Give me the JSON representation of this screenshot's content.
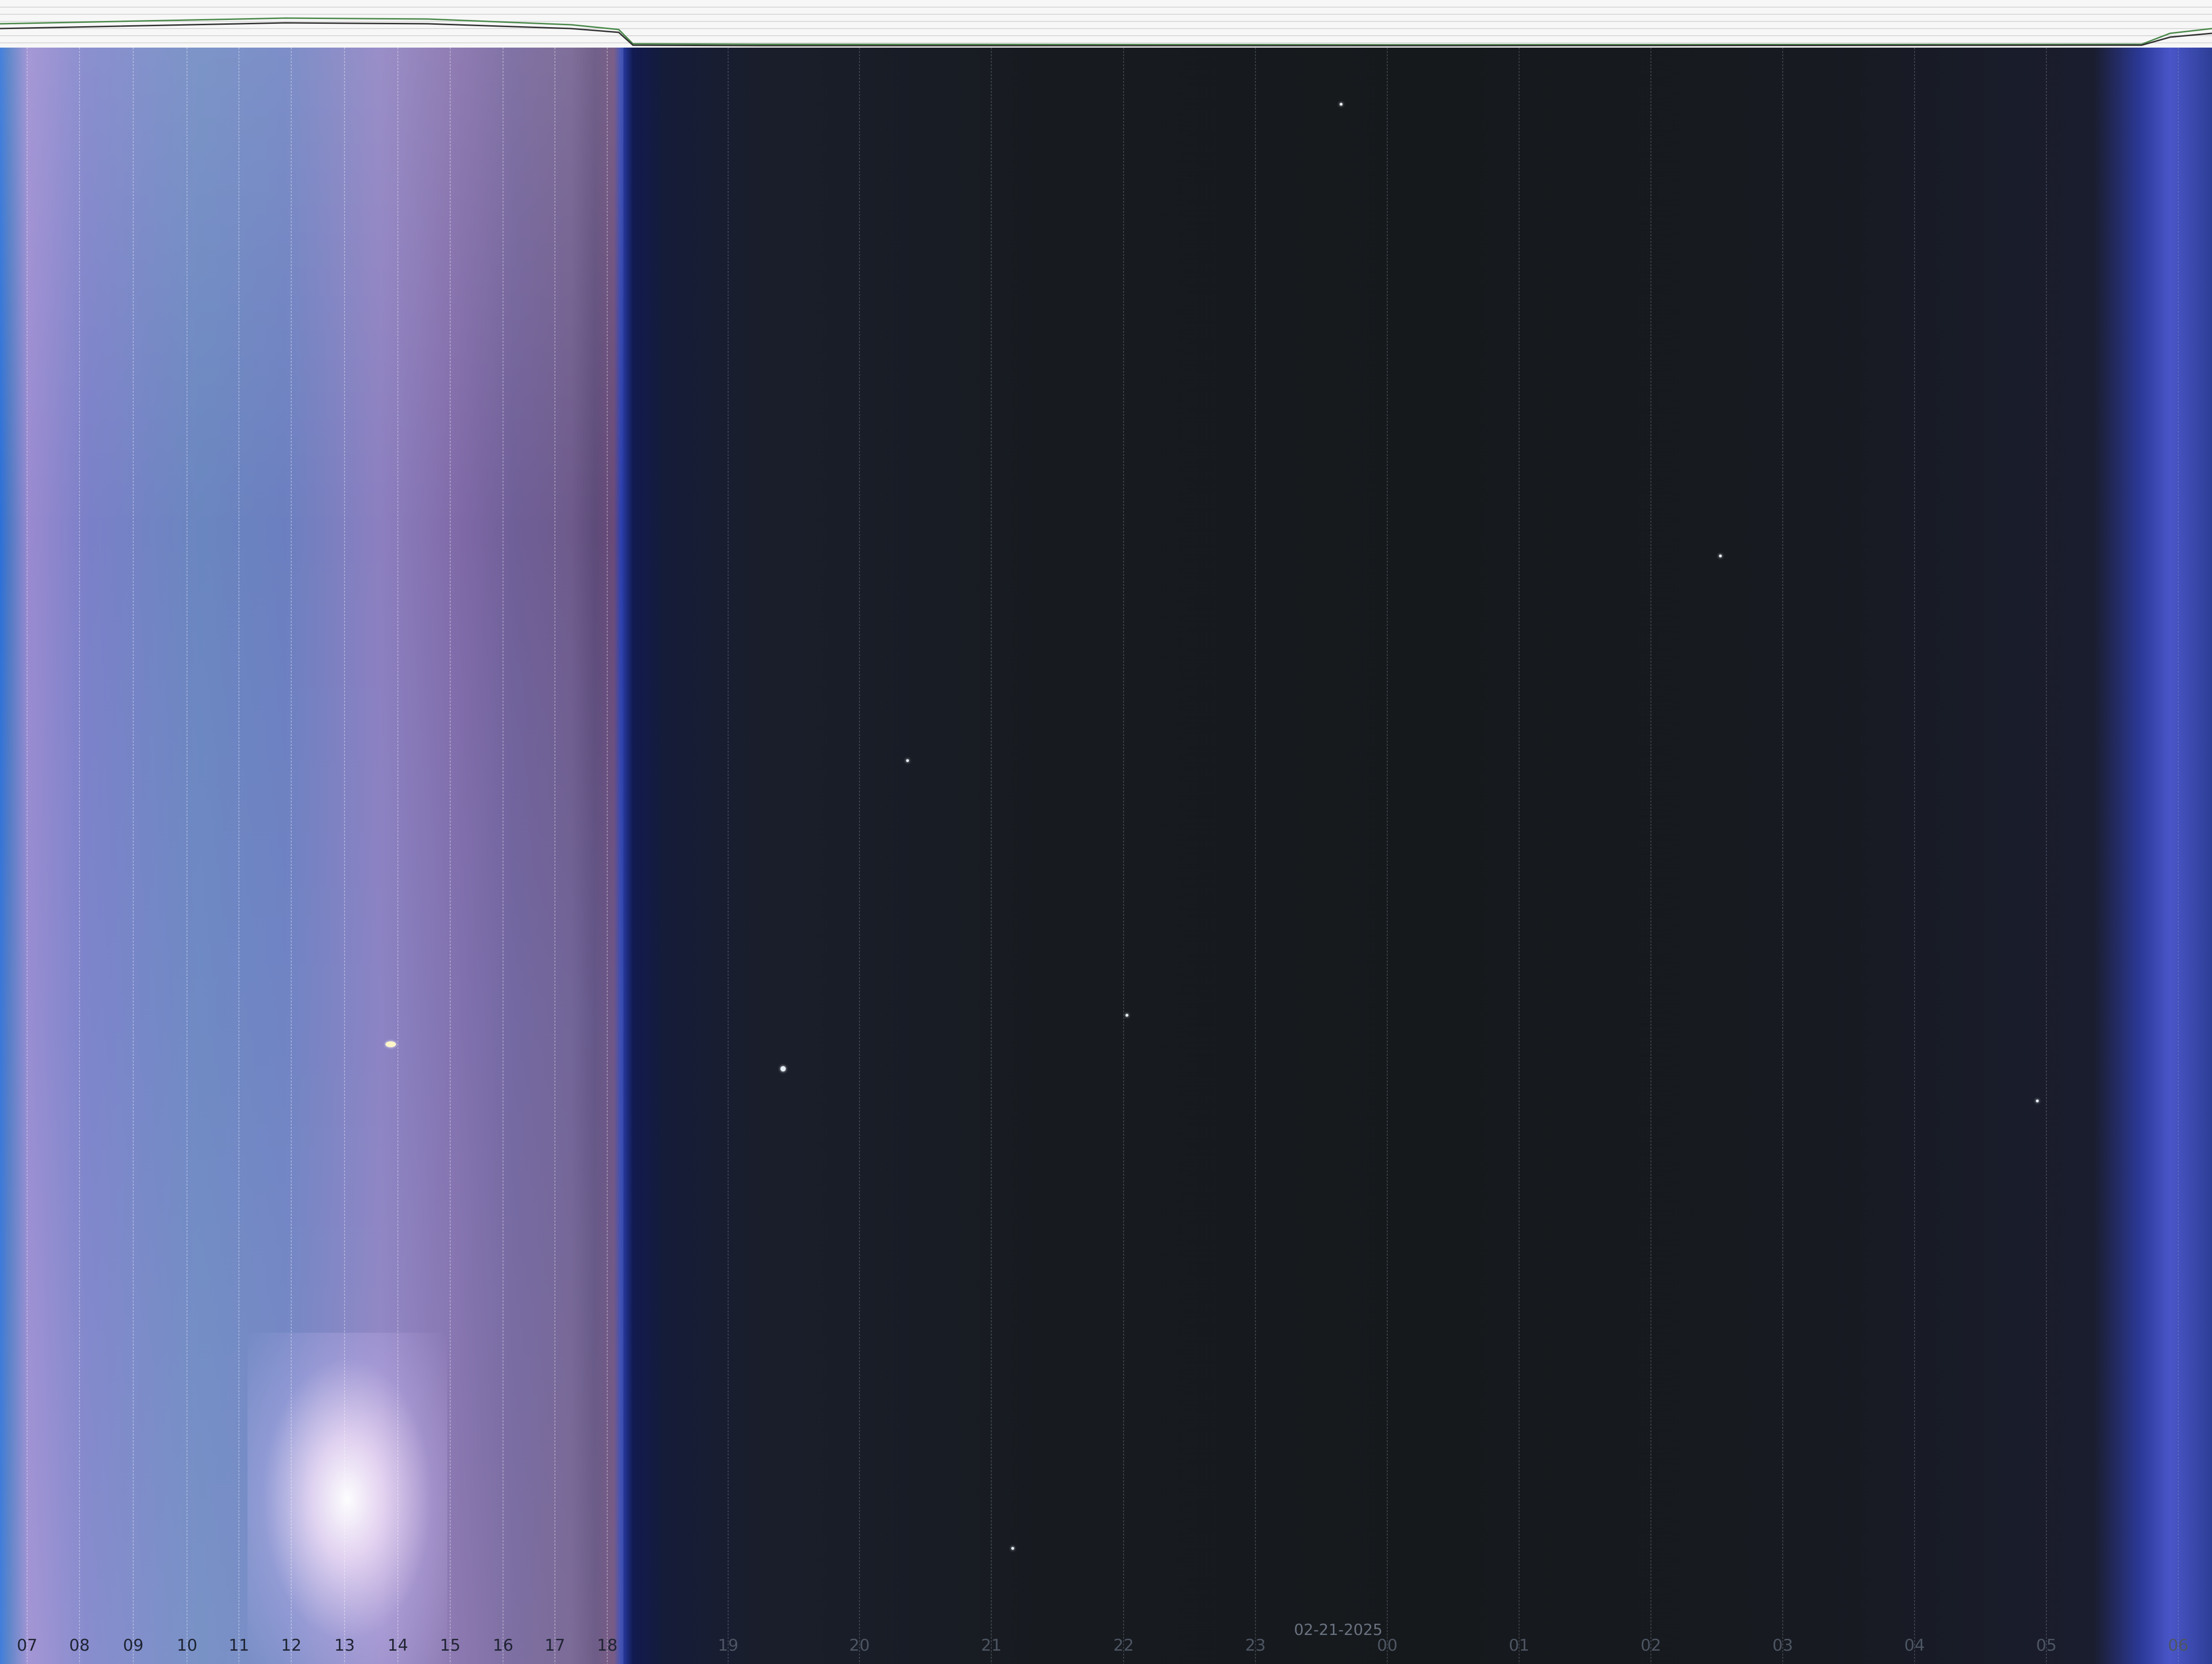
{
  "date": "02-21-2025",
  "hour_labels": [
    "07",
    "08",
    "09",
    "10",
    "11",
    "12",
    "13",
    "14",
    "15",
    "16",
    "17",
    "18",
    "19",
    "20",
    "21",
    "22",
    "23",
    "00",
    "01",
    "02",
    "03",
    "04",
    "05",
    "06"
  ],
  "colors": {
    "day_sky": "#7b80c8",
    "night_sky": "#171b20",
    "dawn_edge": "#4a56c8",
    "sun_glare": "#ffffff",
    "grid_line": "#8a8f9c"
  }
}
